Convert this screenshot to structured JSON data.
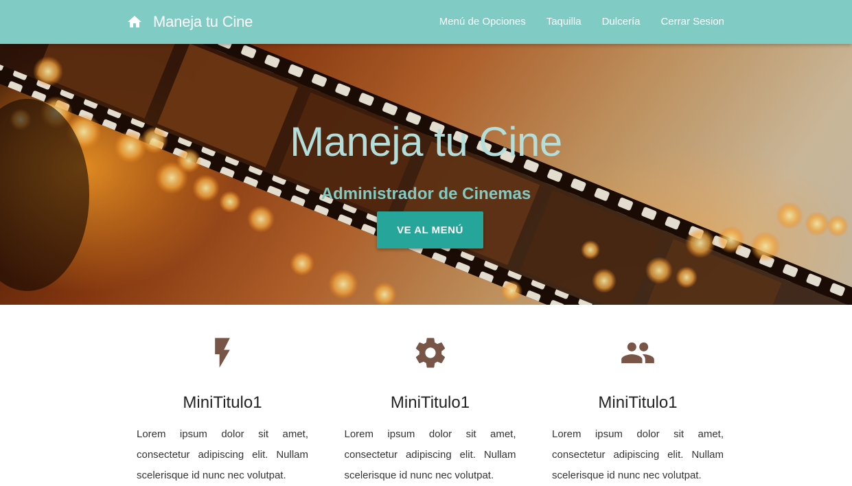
{
  "navbar": {
    "brand": "Maneja tu Cine",
    "brand_icon": "home-icon",
    "links": [
      "Menú de Opciones",
      "Taquilla",
      "Dulcería",
      "Cerrar Sesion"
    ]
  },
  "hero": {
    "title": "Maneja tu Cine",
    "subtitle": "Administrador de Cinemas",
    "button": "VE AL MENÚ"
  },
  "features": [
    {
      "icon": "flash-icon",
      "title": "MiniTitulo1",
      "text": "Lorem ipsum dolor sit amet, consectetur adipiscing elit. Nullam scelerisque id nunc nec volutpat."
    },
    {
      "icon": "gear-icon",
      "title": "MiniTitulo1",
      "text": "Lorem ipsum dolor sit amet, consectetur adipiscing elit. Nullam scelerisque id nunc nec volutpat."
    },
    {
      "icon": "group-icon",
      "title": "MiniTitulo1",
      "text": "Lorem ipsum dolor sit amet, consectetur adipiscing elit. Nullam scelerisque id nunc nec volutpat."
    }
  ],
  "colors": {
    "navbar": "#80cbc4",
    "button": "#26a69a",
    "hero_title": "#b2dfdb",
    "hero_subtitle": "#80cbc4",
    "icon": "#795548"
  }
}
